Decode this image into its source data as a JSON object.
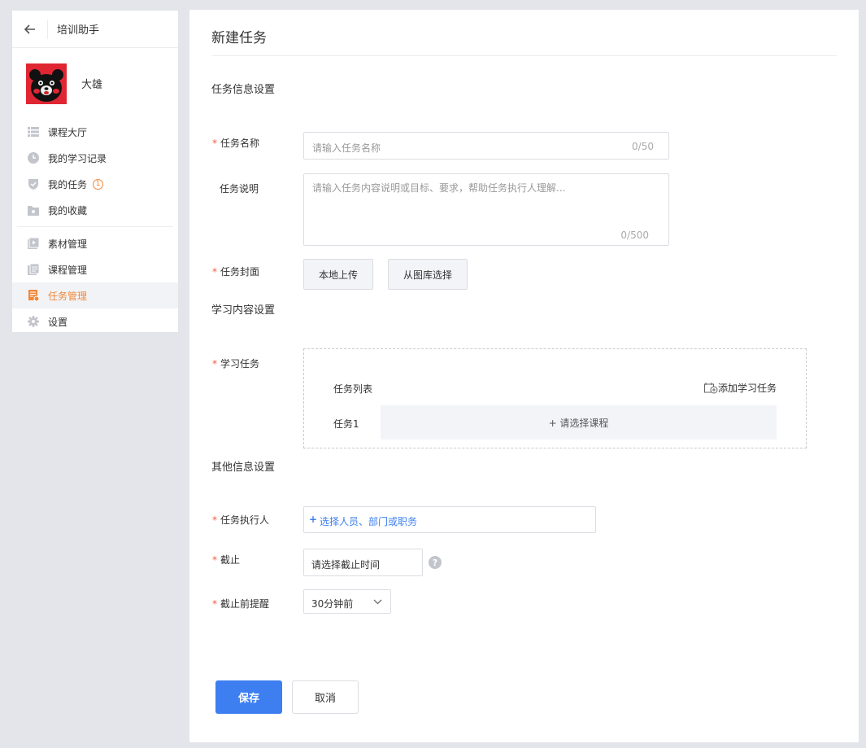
{
  "sidebar": {
    "title": "培训助手",
    "user": {
      "name": "大雄"
    },
    "items": [
      {
        "label": "课程大厅",
        "icon": "list-icon"
      },
      {
        "label": "我的学习记录",
        "icon": "clock-icon"
      },
      {
        "label": "我的任务",
        "icon": "shield-icon",
        "badge": "1"
      },
      {
        "label": "我的收藏",
        "icon": "folder-icon"
      },
      {
        "label": "素材管理",
        "icon": "video-icon"
      },
      {
        "label": "课程管理",
        "icon": "document-icon"
      },
      {
        "label": "任务管理",
        "icon": "task-icon"
      },
      {
        "label": "设置",
        "icon": "gear-icon"
      }
    ]
  },
  "main": {
    "title": "新建任务",
    "sections": {
      "info": "任务信息设置",
      "content": "学习内容设置",
      "other": "其他信息设置"
    },
    "fields": {
      "name_label": "任务名称",
      "name_placeholder": "请输入任务名称",
      "name_count": "0/50",
      "desc_label": "任务说明",
      "desc_placeholder": "请输入任务内容说明或目标、要求，帮助任务执行人理解...",
      "desc_count": "0/500",
      "cover_label": "任务封面",
      "cover_upload": "本地上传",
      "cover_library": "从图库选择",
      "study_label": "学习任务",
      "task_list": "任务列表",
      "add_task": "添加学习任务",
      "task1": "任务1",
      "choose_course": "+ 请选择课程",
      "executor_label": "任务执行人",
      "executor_placeholder": "选择人员、部门或职务",
      "deadline_label": "截止",
      "deadline_placeholder": "请选择截止时间",
      "reminder_label": "截止前提醒",
      "reminder_value": "30分钟前"
    },
    "actions": {
      "save": "保存",
      "cancel": "取消"
    }
  },
  "colors": {
    "accent": "#3d7ff1",
    "active": "#f0883a",
    "required": "#f25c3f"
  }
}
